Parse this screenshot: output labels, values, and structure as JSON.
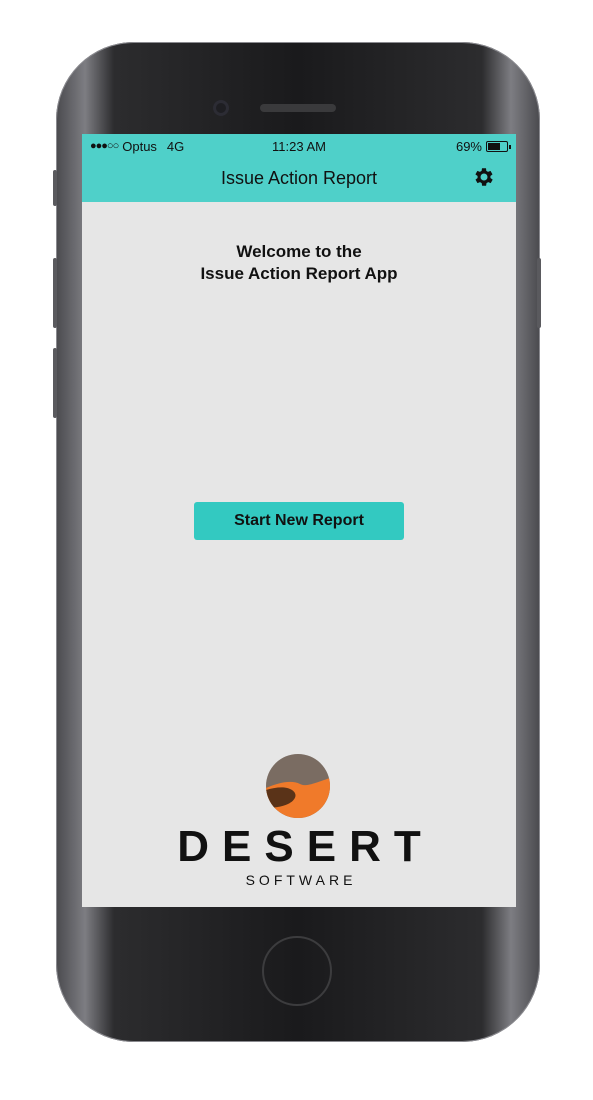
{
  "status_bar": {
    "signal": "●●●○○",
    "carrier": "Optus",
    "network": "4G",
    "time": "11:23 AM",
    "battery_percent": "69%",
    "battery_level": 0.69
  },
  "header": {
    "title": "Issue Action Report",
    "settings_icon": "gear-icon",
    "background_color": "#4fd0c9"
  },
  "main": {
    "welcome_line1": "Welcome to the",
    "welcome_line2": "Issue Action Report App",
    "start_button_label": "Start New Report",
    "button_color": "#33c9c1"
  },
  "footer_logo": {
    "name": "DESERT",
    "subtitle": "SOFTWARE",
    "mark_icon": "desert-dune-logo-icon",
    "mark_colors": [
      "#7a6c62",
      "#f07a2a",
      "#5a3318"
    ]
  }
}
